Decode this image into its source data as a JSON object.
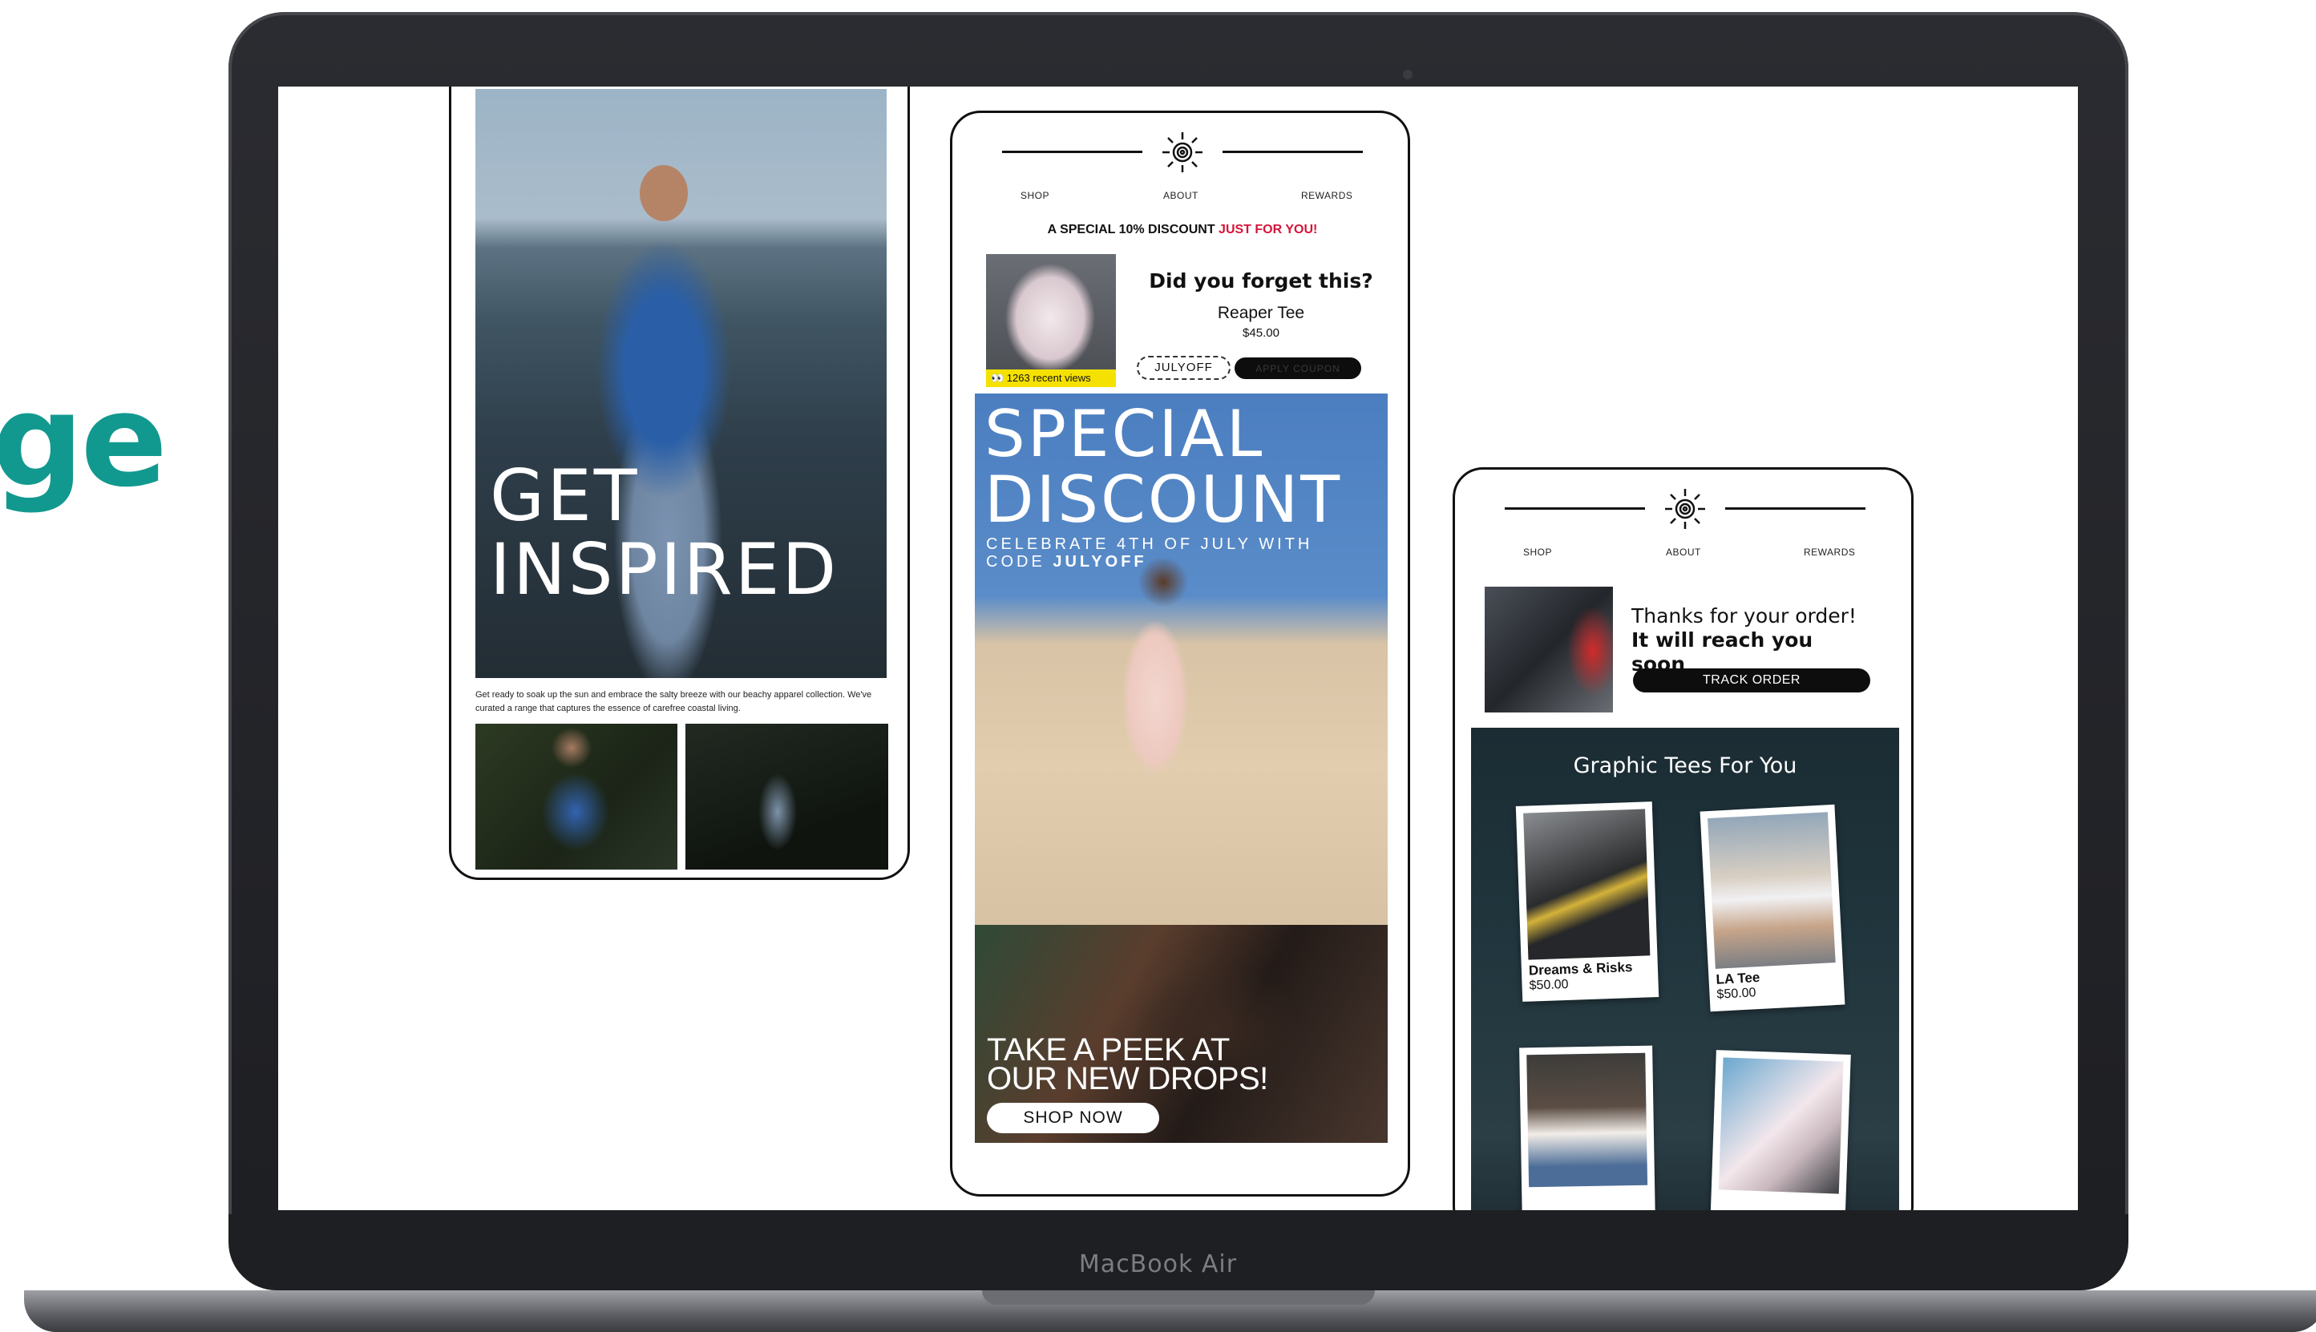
{
  "side_heading": "ge",
  "laptop": {
    "brand": "MacBook Air"
  },
  "email_inspired": {
    "headline": [
      "GET",
      "INSPIRED"
    ],
    "copy": "Get ready to soak up the sun and embrace the salty breeze with our beachy apparel collection. We've curated a range that captures the essence of carefree coastal living."
  },
  "nav": {
    "shop": "SHOP",
    "about": "ABOUT",
    "rewards": "REWARDS"
  },
  "email_discount": {
    "promo_text": "A SPECIAL 10% DISCOUNT ",
    "promo_accent": "JUST FOR YOU!",
    "views_badge": "👀 1263 recent views",
    "forget_title": "Did you forget this?",
    "product_name": "Reaper Tee",
    "product_price": "$45.00",
    "coupon_code": "JULYOFF",
    "apply_label": "APPLY COUPON",
    "hero_title": [
      "SPECIAL",
      "DISCOUNT"
    ],
    "hero_sub_line1": "CELEBRATE 4TH OF JULY WITH",
    "hero_sub_line2_prefix": "CODE ",
    "hero_sub_code": "JULYOFF",
    "drops_title": [
      "TAKE A PEEK AT",
      "OUR NEW DROPS!"
    ],
    "shop_now": "SHOP NOW"
  },
  "email_order": {
    "thanks_line1": "Thanks for your order!",
    "thanks_line2": "It will reach you soon",
    "track_label": "TRACK ORDER",
    "panel_title": "Graphic Tees For You",
    "products": [
      {
        "name": "Dreams & Risks",
        "price": "$50.00"
      },
      {
        "name": "LA Tee",
        "price": "$50.00"
      }
    ]
  },
  "colors": {
    "heading_teal": "#12998f",
    "promo_red": "#d4143a",
    "badge_yellow": "#f5e100"
  }
}
